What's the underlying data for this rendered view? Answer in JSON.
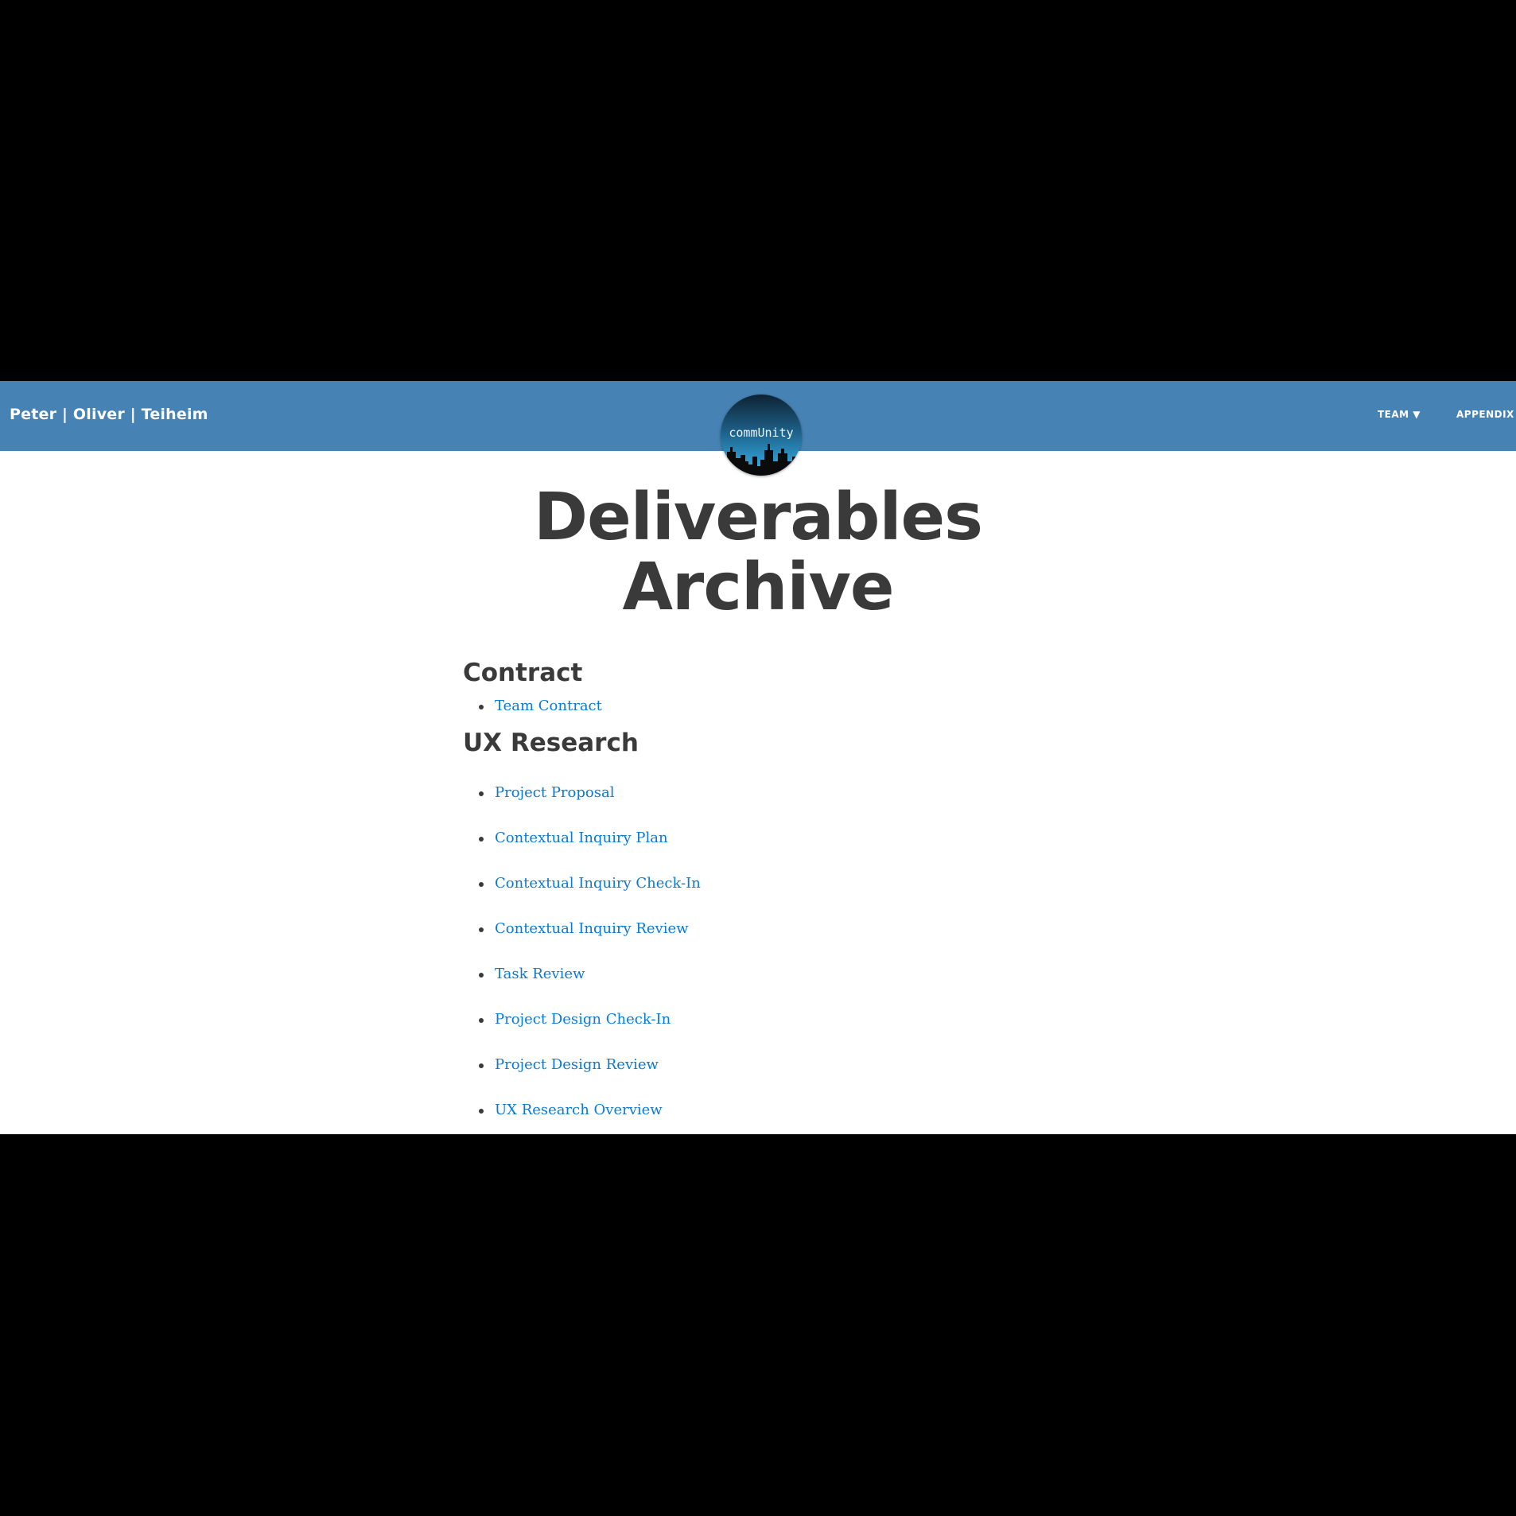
{
  "nav": {
    "brand": "Peter | Oliver | Teiheim",
    "team_label": "TEAM ▼",
    "appendix_label": "APPENDIX",
    "bar_color": "#4682b4"
  },
  "logo": {
    "text": "commUnity"
  },
  "page": {
    "title_line1": "Deliverables",
    "title_line2": "Archive"
  },
  "sections": {
    "contract": {
      "heading": "Contract",
      "items": [
        "Team Contract"
      ]
    },
    "ux_research": {
      "heading": "UX Research",
      "items": [
        "Project Proposal",
        "Contextual Inquiry Plan",
        "Contextual Inquiry Check-In",
        "Contextual Inquiry Review",
        "Task Review",
        "Project Design Check-In",
        "Project Design Review",
        "UX Research Overview"
      ]
    }
  },
  "colors": {
    "link": "#0a7ad4",
    "heading": "#3a3a3a",
    "letterbox": "#000000"
  }
}
